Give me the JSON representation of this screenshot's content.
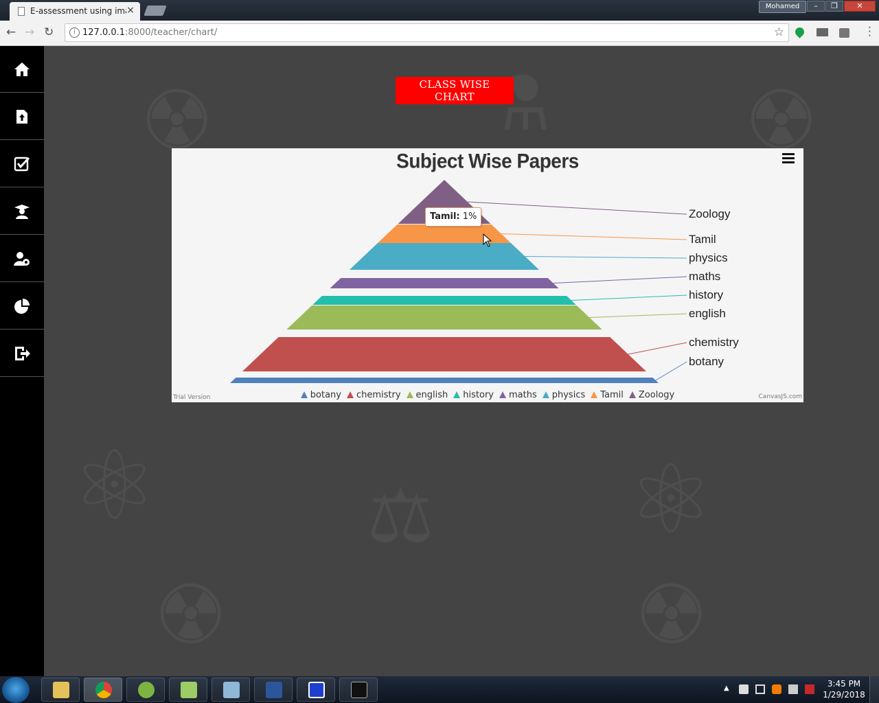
{
  "browser": {
    "tab_title": "E-assessment using imag",
    "tab_close": "×",
    "user_name": "Mohamed",
    "url_host": "127.0.0.1",
    "url_rest": ":8000/teacher/chart/",
    "window_buttons": {
      "minimize": "–",
      "maximize": "❐",
      "close": "✕"
    }
  },
  "sidebar": {
    "items": [
      {
        "icon": "home-icon"
      },
      {
        "icon": "upload-icon"
      },
      {
        "icon": "checkbox-icon"
      },
      {
        "icon": "student-icon"
      },
      {
        "icon": "user-settings-icon"
      },
      {
        "icon": "pie-chart-icon"
      },
      {
        "icon": "logout-icon"
      }
    ]
  },
  "main": {
    "class_wise_button": "CLASS WISE CHART"
  },
  "chart_panel": {
    "trial_label": "Trial Version",
    "credit_label": "CanvasJS.com",
    "tooltip": {
      "label": "Tamil:",
      "value": "1%"
    }
  },
  "chart_data": {
    "type": "pyramid",
    "title": "Subject Wise Papers",
    "series": [
      {
        "name": "botany",
        "color": "#4f81bc"
      },
      {
        "name": "chemistry",
        "color": "#c0504e"
      },
      {
        "name": "english",
        "color": "#9bbb58"
      },
      {
        "name": "history",
        "color": "#23bfaa"
      },
      {
        "name": "maths",
        "color": "#8064a1"
      },
      {
        "name": "physics",
        "color": "#4aacc5"
      },
      {
        "name": "Tamil",
        "color": "#f79647"
      },
      {
        "name": "Zoology",
        "color": "#7f6084"
      }
    ],
    "legend_position": "bottom",
    "index_labels_position": "right"
  },
  "taskbar": {
    "apps": [
      {
        "icon": "file-explorer-icon"
      },
      {
        "icon": "chrome-icon"
      },
      {
        "icon": "chameleon-app-icon"
      },
      {
        "icon": "notepad-plus-plus-icon"
      },
      {
        "icon": "notepad-icon"
      },
      {
        "icon": "word-icon"
      },
      {
        "icon": "blue-app-icon"
      },
      {
        "icon": "command-prompt-icon"
      }
    ],
    "time": "3:45 PM",
    "date": "1/29/2018"
  }
}
